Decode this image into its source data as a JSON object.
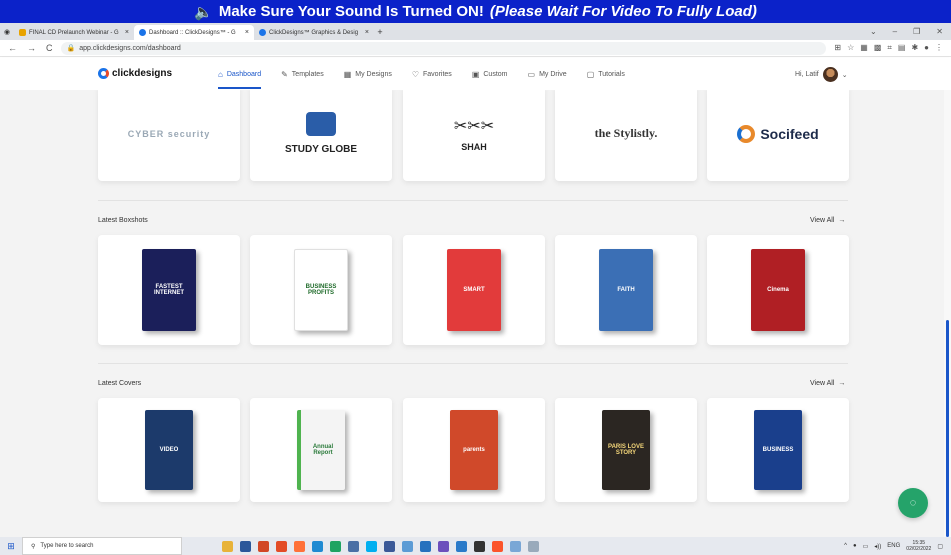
{
  "banner": {
    "main": "Make Sure Your Sound Is Turned ON!",
    "sub": "(Please Wait For Video To Fully Load)",
    "icon": "speaker-icon"
  },
  "tabs": [
    {
      "title": "FINAL CD Prelaunch Webinar - G",
      "active": false
    },
    {
      "title": "Dashboard :: ClickDesigns™ - G",
      "active": true
    },
    {
      "title": "ClickDesigns™ Graphics & Desig",
      "active": false
    }
  ],
  "address": {
    "url": "app.clickdesigns.com/dashboard"
  },
  "brand": {
    "name": "clickdesigns"
  },
  "nav": [
    {
      "label": "Dashboard",
      "icon": "home-icon",
      "active": true
    },
    {
      "label": "Templates",
      "icon": "brush-icon"
    },
    {
      "label": "My Designs",
      "icon": "grid-icon"
    },
    {
      "label": "Favorites",
      "icon": "heart-icon"
    },
    {
      "label": "Custom",
      "icon": "custom-icon"
    },
    {
      "label": "My Drive",
      "icon": "folder-icon"
    },
    {
      "label": "Tutorials",
      "icon": "tutorial-icon"
    }
  ],
  "user": {
    "greeting": "Hi, Latif"
  },
  "logos": [
    {
      "text": "CYBER security",
      "color": "#9aa8b5"
    },
    {
      "text": "STUDY GLOBE",
      "color": "#222222"
    },
    {
      "text": "SHAH",
      "color": "#222222"
    },
    {
      "text": "the Stylistly.",
      "color": "#333333"
    },
    {
      "text": "Socifeed",
      "color": "#1d2b4a"
    }
  ],
  "sections": [
    {
      "title": "Latest Boxshots",
      "view_all": "View All"
    },
    {
      "title": "Latest Covers",
      "view_all": "View All"
    }
  ],
  "boxshots": [
    {
      "text": "FASTEST INTERNET",
      "bg": "#1b1f5a"
    },
    {
      "text": "BUSINESS PROFITS",
      "bg": "#ffffff",
      "fg": "#1f6b2a"
    },
    {
      "text": "SMART",
      "bg": "#e23b3b"
    },
    {
      "text": "FAITH",
      "bg": "#3b6fb5"
    },
    {
      "text": "Cinema",
      "bg": "#b01f24"
    }
  ],
  "covers": [
    {
      "text": "VIDEO",
      "bg": "#1c3a6b",
      "fg": "#ffffff"
    },
    {
      "text": "Annual Report",
      "bg": "#f4f4f4",
      "fg": "#2a7a3a"
    },
    {
      "text": "parents",
      "bg": "#d0492a",
      "fg": "#ffffff"
    },
    {
      "text": "PARIS LOVE STORY",
      "bg": "#2b2622",
      "fg": "#f5d77a"
    },
    {
      "text": "BUSINESS",
      "bg": "#1a3f8c",
      "fg": "#ffffff"
    }
  ],
  "taskbar": {
    "search_placeholder": "Type here to search",
    "lang": "ENG",
    "time": "15:35",
    "date": "02/02/2022"
  }
}
